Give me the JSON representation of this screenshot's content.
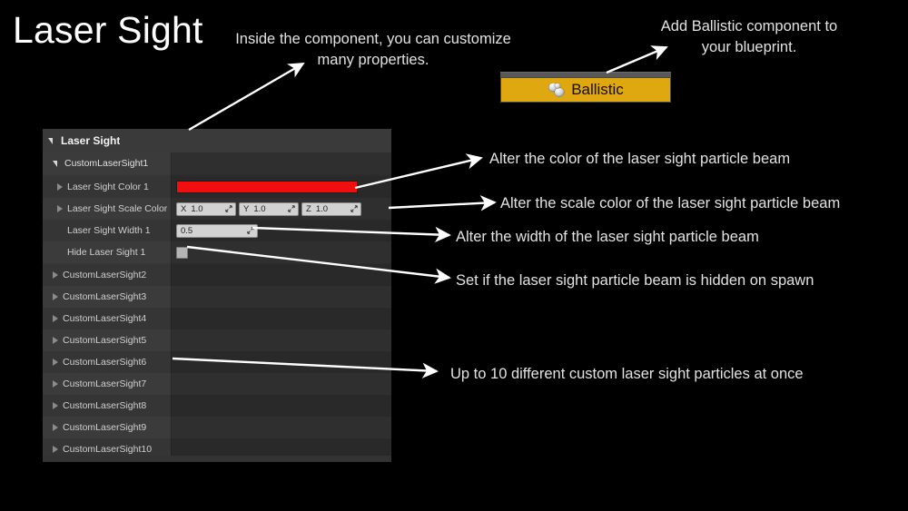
{
  "page": {
    "title": "Laser Sight",
    "background_color": "#000000"
  },
  "annotations": [
    {
      "id": "inside-component",
      "text": "Inside the component, you can customize\nmany properties."
    },
    {
      "id": "add-ballistic",
      "text": "Add Ballistic component to\nyour blueprint."
    },
    {
      "id": "alter-color",
      "text": "Alter the color of the laser sight particle beam"
    },
    {
      "id": "alter-scale",
      "text": "Alter the scale color of the laser sight particle beam"
    },
    {
      "id": "alter-width",
      "text": "Alter the width of the laser sight particle beam"
    },
    {
      "id": "hidden-on-spawn",
      "text": "Set if the laser sight particle beam is hidden on spawn"
    },
    {
      "id": "up-to-ten",
      "text": "Up to 10 different custom laser sight particles at once"
    }
  ],
  "ballistic": {
    "label": "Ballistic",
    "icon": "component-spheres-icon",
    "accent_color": "#e0a810",
    "text_color": "#0d0d0d"
  },
  "details_panel": {
    "header": {
      "label": "Laser Sight",
      "expander": "triangle-down-filled"
    },
    "component": {
      "label": "CustomLaserSight1",
      "expander": "triangle-down-filled"
    },
    "properties": [
      {
        "label": "Laser Sight Color 1",
        "expander": "triangle-right-hollow",
        "widget": "color-swatch",
        "color": "#f00e0e"
      },
      {
        "label": "Laser Sight Scale Color 1",
        "expander": "triangle-right-hollow",
        "widget": "vector3",
        "axes": [
          {
            "axis": "X",
            "value": "1.0"
          },
          {
            "axis": "Y",
            "value": "1.0"
          },
          {
            "axis": "Z",
            "value": "1.0"
          }
        ]
      },
      {
        "label": "Laser Sight Width 1",
        "expander": "none",
        "widget": "number",
        "value": "0.5"
      },
      {
        "label": "Hide Laser Sight 1",
        "expander": "none",
        "widget": "checkbox",
        "checked": false
      }
    ],
    "other_components": [
      {
        "label": "CustomLaserSight2",
        "expander": "triangle-right-hollow"
      },
      {
        "label": "CustomLaserSight3",
        "expander": "triangle-right-hollow"
      },
      {
        "label": "CustomLaserSight4",
        "expander": "triangle-right-hollow"
      },
      {
        "label": "CustomLaserSight5",
        "expander": "triangle-right-hollow"
      },
      {
        "label": "CustomLaserSight6",
        "expander": "triangle-right-hollow"
      },
      {
        "label": "CustomLaserSight7",
        "expander": "triangle-right-hollow"
      },
      {
        "label": "CustomLaserSight8",
        "expander": "triangle-right-hollow"
      },
      {
        "label": "CustomLaserSight9",
        "expander": "triangle-right-hollow"
      },
      {
        "label": "CustomLaserSight10",
        "expander": "triangle-right-hollow"
      }
    ]
  }
}
